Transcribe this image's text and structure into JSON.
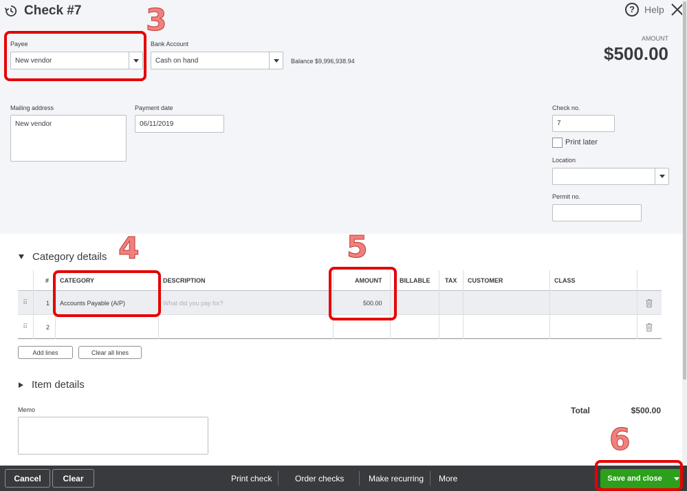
{
  "header": {
    "title": "Check #7",
    "help_label": "Help"
  },
  "payee": {
    "label": "Payee",
    "value": "New vendor"
  },
  "bank_account": {
    "label": "Bank Account",
    "value": "Cash on hand",
    "balance": "Balance $9,996,938.94"
  },
  "amount": {
    "label": "AMOUNT",
    "value": "$500.00"
  },
  "mailing_address": {
    "label": "Mailing address",
    "value": "New vendor"
  },
  "payment_date": {
    "label": "Payment date",
    "value": "06/11/2019"
  },
  "check_no": {
    "label": "Check no.",
    "value": "7"
  },
  "print_later": {
    "label": "Print later",
    "checked": false
  },
  "location": {
    "label": "Location",
    "value": ""
  },
  "permit_no": {
    "label": "Permit no.",
    "value": ""
  },
  "category_details": {
    "title": "Category details",
    "columns": [
      "#",
      "CATEGORY",
      "DESCRIPTION",
      "AMOUNT",
      "BILLABLE",
      "TAX",
      "CUSTOMER",
      "CLASS"
    ],
    "rows": [
      {
        "num": "1",
        "category": "Accounts Payable (A/P)",
        "description_placeholder": "What did you pay for?",
        "amount": "500.00"
      },
      {
        "num": "2",
        "category": "",
        "description_placeholder": "",
        "amount": ""
      }
    ],
    "add_lines": "Add lines",
    "clear_all_lines": "Clear all lines"
  },
  "item_details": {
    "title": "Item details"
  },
  "memo": {
    "label": "Memo",
    "value": ""
  },
  "total": {
    "label": "Total",
    "value": "$500.00"
  },
  "footer": {
    "cancel": "Cancel",
    "clear": "Clear",
    "print_check": "Print check",
    "order_checks": "Order checks",
    "make_recurring": "Make recurring",
    "more": "More",
    "save_and_close": "Save and close"
  },
  "annotations": [
    "3",
    "4",
    "5",
    "6"
  ],
  "colors": {
    "header_bg": "#f4f5f8",
    "footer_bg": "#393a3d",
    "save_green": "#2ca01c",
    "annotation_red": "#e60000"
  }
}
